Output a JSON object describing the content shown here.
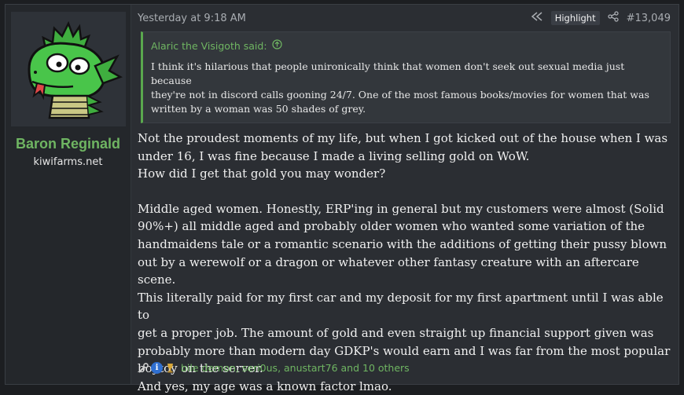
{
  "user": {
    "name": "Baron Reginald",
    "title": "kiwifarms.net",
    "avatar_icon": "green-dragon-avatar-icon"
  },
  "post": {
    "timestamp": "Yesterday at 9:18 AM",
    "highlight_label": "Highlight",
    "post_number": "#13,049",
    "jump_icon": "rewind-icon",
    "share_icon": "share-icon"
  },
  "quote": {
    "author": "Alaric the Visigoth said:",
    "jump_icon": "circle-arrow-up-icon",
    "lines": [
      "I think it's hilarious that people unironically think that women don't seek out sexual media just because",
      "they're not in discord calls gooning 24/7. One of the most famous books/movies for women that was",
      "written by a woman was 50 shades of grey."
    ]
  },
  "message": {
    "lines": [
      "Not the proudest moments of my life, but when I got kicked out of the house when I was",
      "under 16, I was fine because I made a living selling gold on WoW.",
      "How did I get that gold you may wonder?",
      "",
      "Middle aged women. Honestly, ERP'ing in general but my customers were almost (Solid",
      "90%+) all middle aged and probably older women who wanted some variation of the",
      "handmaidens tale or a romantic scenario with the additions of getting their pussy blown",
      "out by a werewolf or a dragon or whatever other fantasy creature with an aftercare scene.",
      "This literally paid for my first car and my deposit for my first apartment until I was able to",
      "get a proper job. The amount of gold and even straight up financial support given was",
      "probably more than modern day GDKP's would earn and I was far from the most popular",
      "boytoy on the server.",
      "And yes, my age was a known factor lmao."
    ]
  },
  "reactions": {
    "icons": [
      "wrench-icon",
      "info-icon",
      "trophy-icon"
    ],
    "text": "bile demon, seri0us, anustart76 and 10 others"
  },
  "colors": {
    "accent_green": "#6fb562",
    "background": "#2b2e33"
  }
}
